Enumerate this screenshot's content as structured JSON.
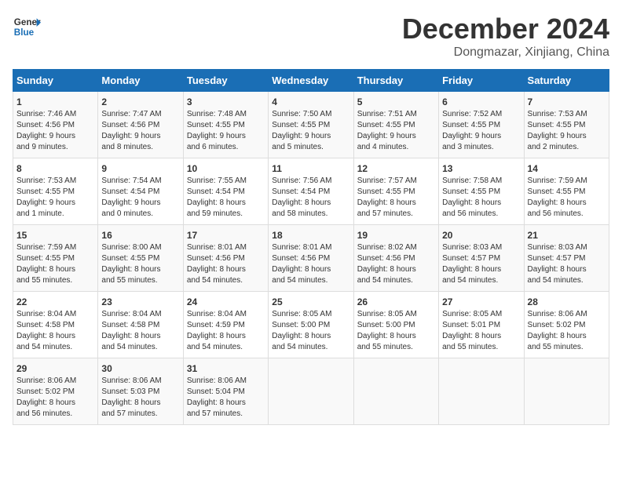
{
  "header": {
    "logo_general": "General",
    "logo_blue": "Blue",
    "title": "December 2024",
    "subtitle": "Dongmazar, Xinjiang, China"
  },
  "days_of_week": [
    "Sunday",
    "Monday",
    "Tuesday",
    "Wednesday",
    "Thursday",
    "Friday",
    "Saturday"
  ],
  "weeks": [
    [
      {
        "day": "1",
        "info": "Sunrise: 7:46 AM\nSunset: 4:56 PM\nDaylight: 9 hours\nand 9 minutes."
      },
      {
        "day": "2",
        "info": "Sunrise: 7:47 AM\nSunset: 4:56 PM\nDaylight: 9 hours\nand 8 minutes."
      },
      {
        "day": "3",
        "info": "Sunrise: 7:48 AM\nSunset: 4:55 PM\nDaylight: 9 hours\nand 6 minutes."
      },
      {
        "day": "4",
        "info": "Sunrise: 7:50 AM\nSunset: 4:55 PM\nDaylight: 9 hours\nand 5 minutes."
      },
      {
        "day": "5",
        "info": "Sunrise: 7:51 AM\nSunset: 4:55 PM\nDaylight: 9 hours\nand 4 minutes."
      },
      {
        "day": "6",
        "info": "Sunrise: 7:52 AM\nSunset: 4:55 PM\nDaylight: 9 hours\nand 3 minutes."
      },
      {
        "day": "7",
        "info": "Sunrise: 7:53 AM\nSunset: 4:55 PM\nDaylight: 9 hours\nand 2 minutes."
      }
    ],
    [
      {
        "day": "8",
        "info": "Sunrise: 7:53 AM\nSunset: 4:55 PM\nDaylight: 9 hours\nand 1 minute."
      },
      {
        "day": "9",
        "info": "Sunrise: 7:54 AM\nSunset: 4:54 PM\nDaylight: 9 hours\nand 0 minutes."
      },
      {
        "day": "10",
        "info": "Sunrise: 7:55 AM\nSunset: 4:54 PM\nDaylight: 8 hours\nand 59 minutes."
      },
      {
        "day": "11",
        "info": "Sunrise: 7:56 AM\nSunset: 4:54 PM\nDaylight: 8 hours\nand 58 minutes."
      },
      {
        "day": "12",
        "info": "Sunrise: 7:57 AM\nSunset: 4:55 PM\nDaylight: 8 hours\nand 57 minutes."
      },
      {
        "day": "13",
        "info": "Sunrise: 7:58 AM\nSunset: 4:55 PM\nDaylight: 8 hours\nand 56 minutes."
      },
      {
        "day": "14",
        "info": "Sunrise: 7:59 AM\nSunset: 4:55 PM\nDaylight: 8 hours\nand 56 minutes."
      }
    ],
    [
      {
        "day": "15",
        "info": "Sunrise: 7:59 AM\nSunset: 4:55 PM\nDaylight: 8 hours\nand 55 minutes."
      },
      {
        "day": "16",
        "info": "Sunrise: 8:00 AM\nSunset: 4:55 PM\nDaylight: 8 hours\nand 55 minutes."
      },
      {
        "day": "17",
        "info": "Sunrise: 8:01 AM\nSunset: 4:56 PM\nDaylight: 8 hours\nand 54 minutes."
      },
      {
        "day": "18",
        "info": "Sunrise: 8:01 AM\nSunset: 4:56 PM\nDaylight: 8 hours\nand 54 minutes."
      },
      {
        "day": "19",
        "info": "Sunrise: 8:02 AM\nSunset: 4:56 PM\nDaylight: 8 hours\nand 54 minutes."
      },
      {
        "day": "20",
        "info": "Sunrise: 8:03 AM\nSunset: 4:57 PM\nDaylight: 8 hours\nand 54 minutes."
      },
      {
        "day": "21",
        "info": "Sunrise: 8:03 AM\nSunset: 4:57 PM\nDaylight: 8 hours\nand 54 minutes."
      }
    ],
    [
      {
        "day": "22",
        "info": "Sunrise: 8:04 AM\nSunset: 4:58 PM\nDaylight: 8 hours\nand 54 minutes."
      },
      {
        "day": "23",
        "info": "Sunrise: 8:04 AM\nSunset: 4:58 PM\nDaylight: 8 hours\nand 54 minutes."
      },
      {
        "day": "24",
        "info": "Sunrise: 8:04 AM\nSunset: 4:59 PM\nDaylight: 8 hours\nand 54 minutes."
      },
      {
        "day": "25",
        "info": "Sunrise: 8:05 AM\nSunset: 5:00 PM\nDaylight: 8 hours\nand 54 minutes."
      },
      {
        "day": "26",
        "info": "Sunrise: 8:05 AM\nSunset: 5:00 PM\nDaylight: 8 hours\nand 55 minutes."
      },
      {
        "day": "27",
        "info": "Sunrise: 8:05 AM\nSunset: 5:01 PM\nDaylight: 8 hours\nand 55 minutes."
      },
      {
        "day": "28",
        "info": "Sunrise: 8:06 AM\nSunset: 5:02 PM\nDaylight: 8 hours\nand 55 minutes."
      }
    ],
    [
      {
        "day": "29",
        "info": "Sunrise: 8:06 AM\nSunset: 5:02 PM\nDaylight: 8 hours\nand 56 minutes."
      },
      {
        "day": "30",
        "info": "Sunrise: 8:06 AM\nSunset: 5:03 PM\nDaylight: 8 hours\nand 57 minutes."
      },
      {
        "day": "31",
        "info": "Sunrise: 8:06 AM\nSunset: 5:04 PM\nDaylight: 8 hours\nand 57 minutes."
      },
      null,
      null,
      null,
      null
    ]
  ]
}
